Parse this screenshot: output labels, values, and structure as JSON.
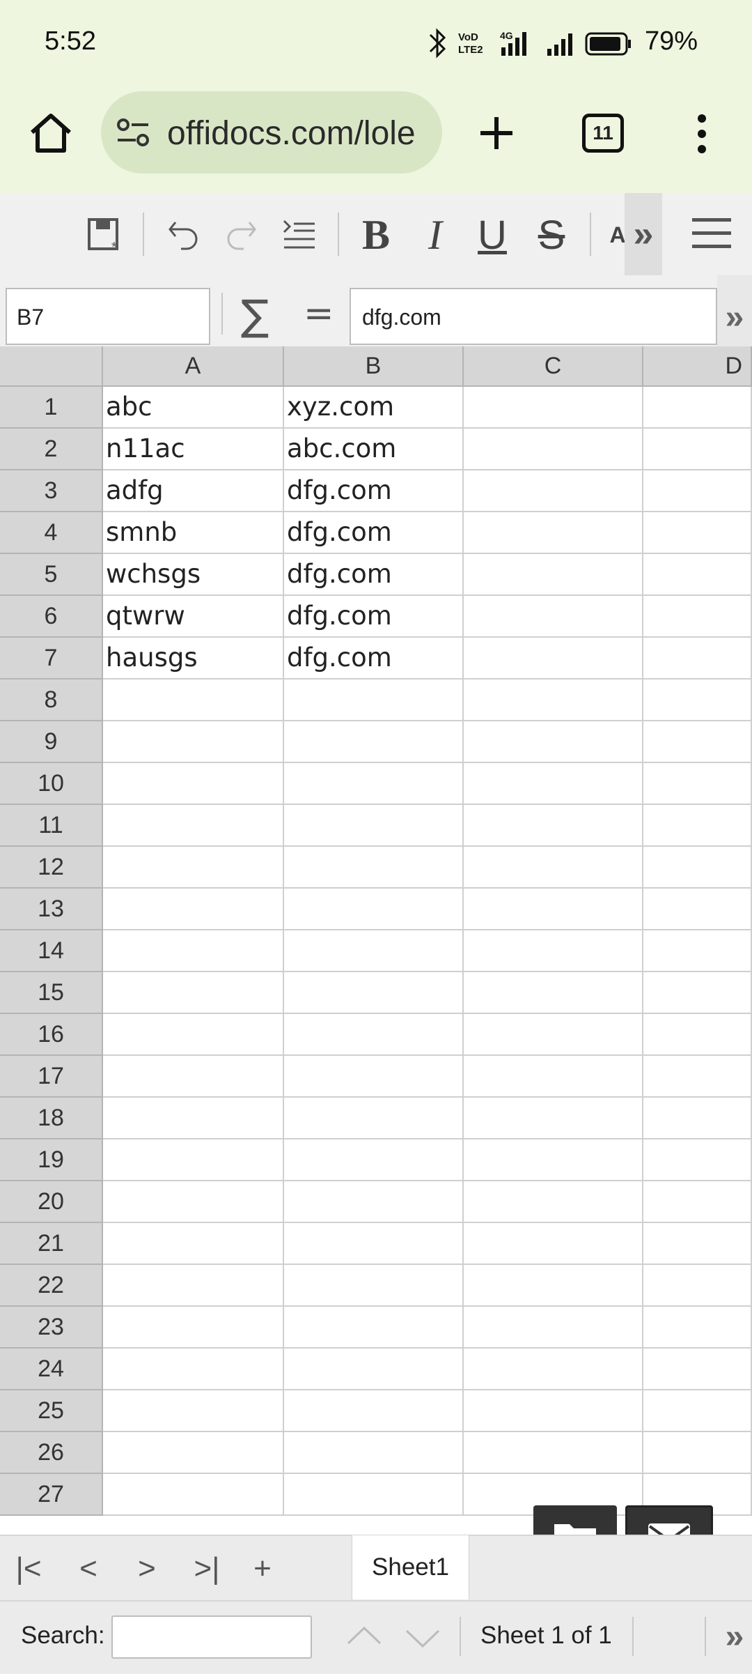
{
  "status": {
    "time": "5:52",
    "battery": "79%",
    "icons": [
      "bluetooth-icon",
      "volte-icon",
      "4g-signal-icon",
      "signal-icon",
      "battery-icon"
    ]
  },
  "browser": {
    "url": "offidocs.com/lole",
    "tab_count": "11"
  },
  "toolbar": {
    "items": [
      "save-icon",
      "undo-icon",
      "redo-icon",
      "wrap-icon",
      "bold-icon",
      "italic-icon",
      "underline-icon",
      "strikethrough-icon"
    ],
    "font_color_label": "A",
    "more_label": "»"
  },
  "formula": {
    "cell_ref": "B7",
    "sum_symbol": "∑",
    "equals_symbol": "=",
    "content": "dfg.com",
    "more_label": "»"
  },
  "sheet": {
    "columns": [
      "A",
      "B",
      "C",
      "D"
    ],
    "rows": [
      "1",
      "2",
      "3",
      "4",
      "5",
      "6",
      "7",
      "8",
      "9",
      "10",
      "11",
      "12",
      "13",
      "14",
      "15",
      "16",
      "17",
      "18",
      "19",
      "20",
      "21",
      "22",
      "23",
      "24",
      "25",
      "26",
      "27"
    ],
    "col_a": [
      "abc",
      "n11ac",
      "adfg",
      "smnb",
      "wchsgs",
      "qtwrw",
      "hausgs"
    ],
    "col_b": [
      "xyz.com",
      "abc.com",
      "dfg.com",
      "dfg.com",
      "dfg.com",
      "dfg.com",
      "dfg.com"
    ]
  },
  "tabs": {
    "nav": [
      "|<",
      "<",
      ">",
      ">|",
      "+"
    ],
    "active": "Sheet1"
  },
  "footer": {
    "search_label": "Search:",
    "search_value": "",
    "sheet_status": "Sheet 1 of 1",
    "more_label": "»"
  }
}
